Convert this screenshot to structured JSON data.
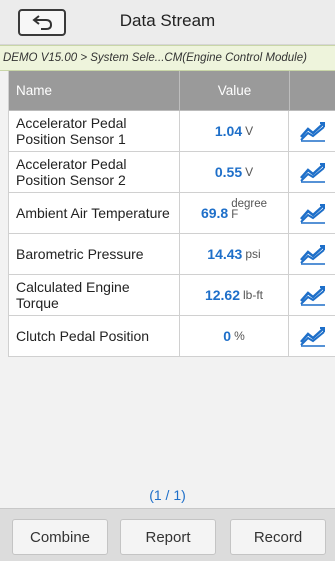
{
  "header": {
    "title": "Data Stream"
  },
  "breadcrumb": "DEMO V15.00 > System Sele...CM(Engine Control Module)",
  "table": {
    "columns": {
      "name": "Name",
      "value": "Value"
    },
    "rows": [
      {
        "name": "Accelerator Pedal Position Sensor 1",
        "value": "1.04",
        "unit": "V"
      },
      {
        "name": "Accelerator Pedal Position Sensor 2",
        "value": "0.55",
        "unit": "V"
      },
      {
        "name": "Ambient Air Temperature",
        "value": "69.8",
        "unit_top": "degree",
        "unit_bottom": "F"
      },
      {
        "name": "Barometric Pressure",
        "value": "14.43",
        "unit": "psi"
      },
      {
        "name": "Calculated Engine Torque",
        "value": "12.62",
        "unit": "lb-ft"
      },
      {
        "name": "Clutch Pedal Position",
        "value": "0",
        "unit": "%"
      }
    ]
  },
  "pager": "(1 / 1)",
  "footer": {
    "combine": "Combine",
    "report": "Report",
    "record": "Record"
  },
  "icons": {
    "back": "back-arrow-icon",
    "graph": "trend-graph-icon"
  },
  "colors": {
    "value": "#1e6fc9",
    "header_bg": "#9a9a9a",
    "breadcrumb_bg": "#eef4dc"
  }
}
